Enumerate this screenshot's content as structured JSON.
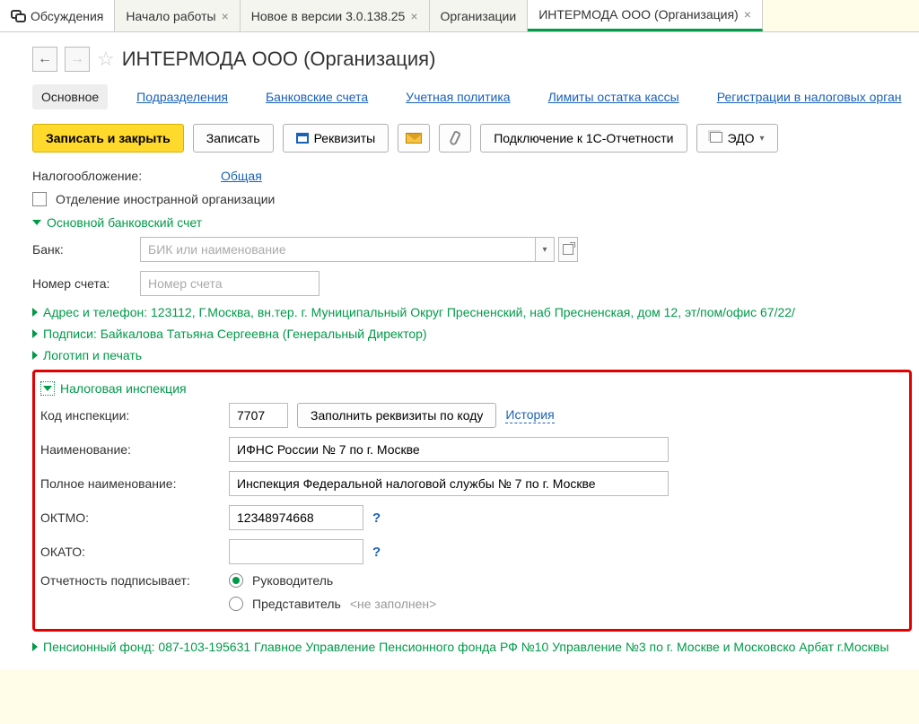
{
  "tabs": [
    {
      "label": "Обсуждения"
    },
    {
      "label": "Начало работы"
    },
    {
      "label": "Новое в версии 3.0.138.25"
    },
    {
      "label": "Организации"
    },
    {
      "label": "ИНТЕРМОДА ООО (Организация)"
    }
  ],
  "page_title": "ИНТЕРМОДА ООО (Организация)",
  "navtabs": [
    "Основное",
    "Подразделения",
    "Банковские счета",
    "Учетная политика",
    "Лимиты остатка кассы",
    "Регистрации в налоговых орган"
  ],
  "toolbar": {
    "save_close": "Записать и закрыть",
    "save": "Записать",
    "requisites": "Реквизиты",
    "connect_1c": "Подключение к 1С-Отчетности",
    "edo": "ЭДО"
  },
  "tax_label": "Налогообложение:",
  "tax_value": "Общая",
  "foreign_branch": "Отделение иностранной организации",
  "section_bank": "Основной банковский счет",
  "bank_label": "Банк:",
  "bank_placeholder": "БИК или наименование",
  "accnum_label": "Номер счета:",
  "accnum_placeholder": "Номер счета",
  "exp_address": "Адрес и телефон: 123112, Г.Москва, вн.тер. г. Муниципальный Округ Пресненский, наб Пресненская, дом 12, эт/пом/офис 67/22/",
  "exp_sign": "Подписи: Байкалова Татьяна Сергеевна (Генеральный Директор)",
  "exp_logo": "Логотип и печать",
  "section_tax": "Налоговая инспекция",
  "inspection": {
    "code_label": "Код инспекции:",
    "code_value": "7707",
    "fill_btn": "Заполнить реквизиты по коду",
    "history": "История",
    "name_label": "Наименование:",
    "name_value": "ИФНС России № 7 по г. Москве",
    "fullname_label": "Полное наименование:",
    "fullname_value": "Инспекция Федеральной налоговой службы № 7 по г. Москве",
    "oktmo_label": "ОКТМО:",
    "oktmo_value": "12348974668",
    "okato_label": "ОКАТО:",
    "okato_value": "",
    "signer_label": "Отчетность подписывает:",
    "opt1": "Руководитель",
    "opt2": "Представитель",
    "opt2_empty": "<не заполнен>"
  },
  "exp_pension": "Пенсионный фонд: 087-103-195631 Главное Управление Пенсионного фонда РФ №10 Управление №3 по г. Москве и Московско Арбат г.Москвы"
}
